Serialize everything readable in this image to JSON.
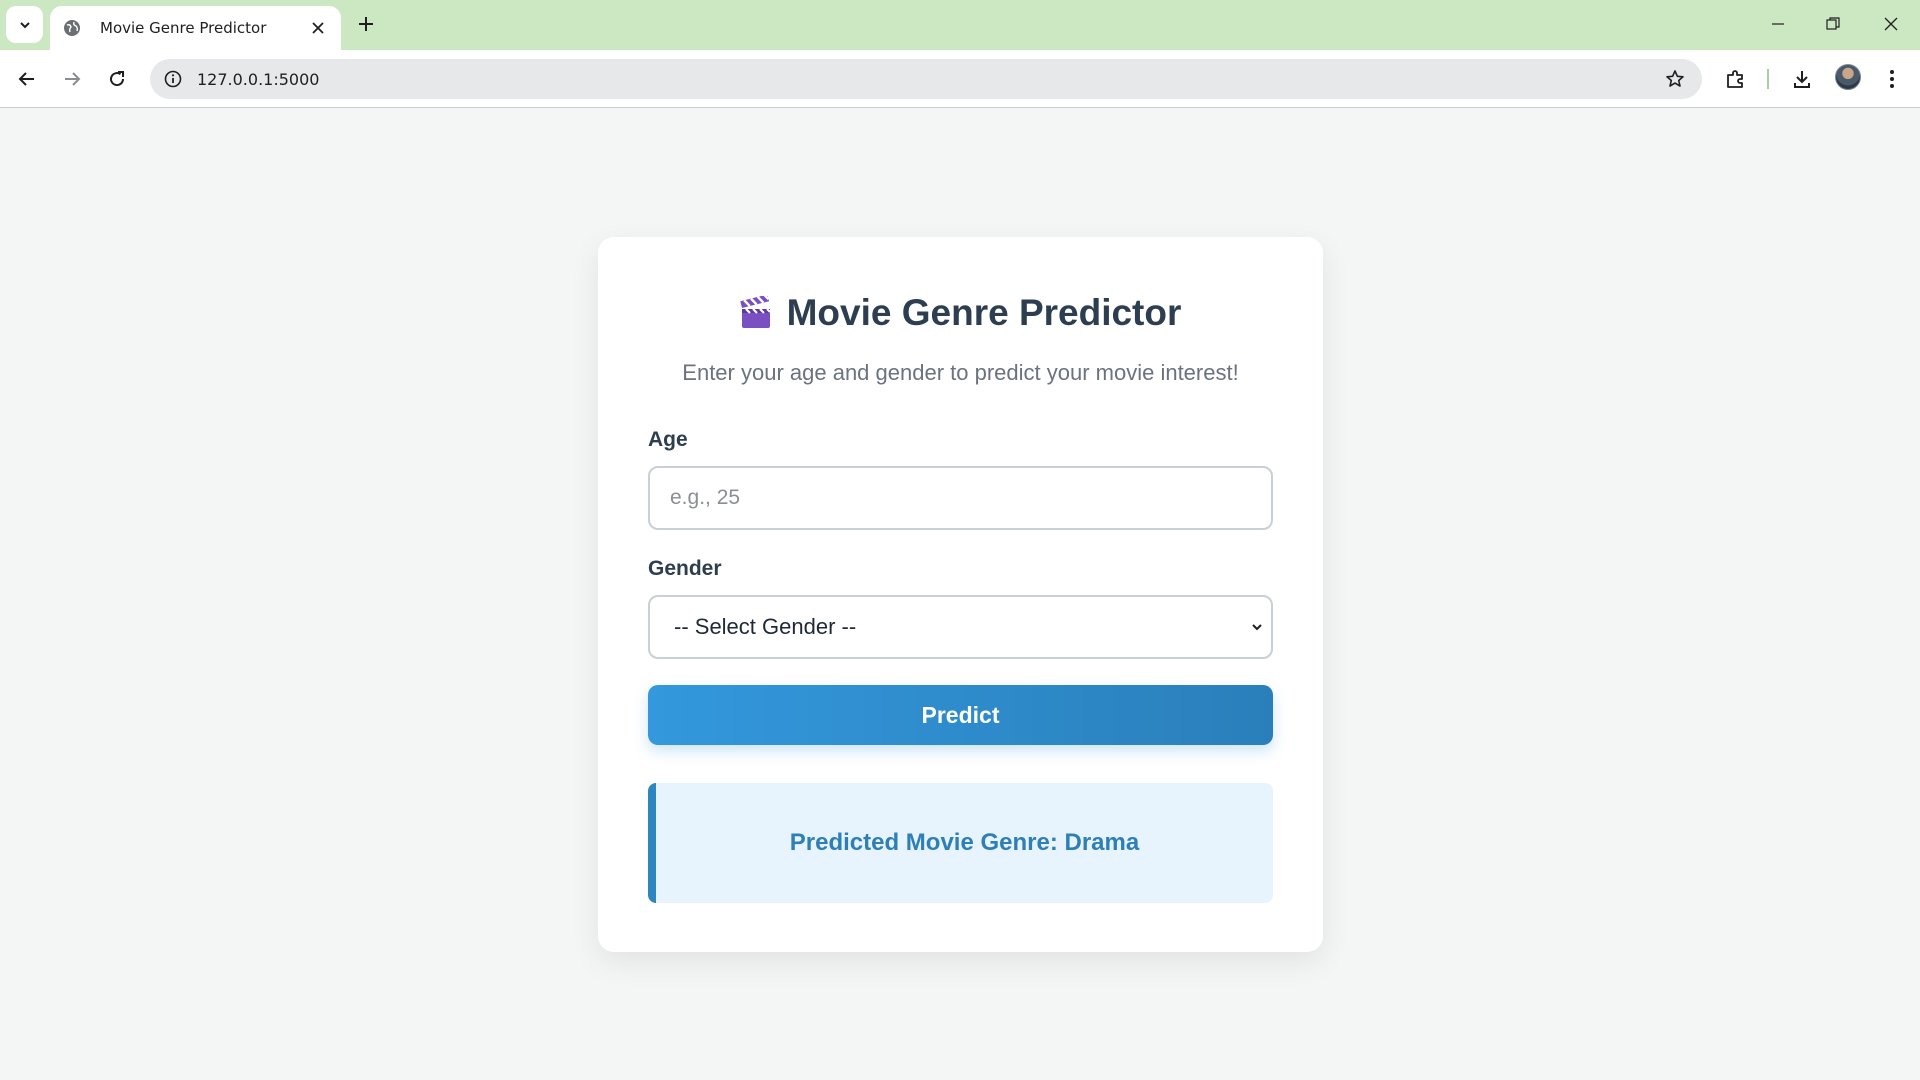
{
  "browser": {
    "tab_title": "Movie Genre Predictor",
    "url": "127.0.0.1:5000"
  },
  "page": {
    "title": "Movie Genre Predictor",
    "subtitle": "Enter your age and gender to predict your movie interest!",
    "age_label": "Age",
    "age_placeholder": "e.g., 25",
    "age_value": "",
    "gender_label": "Gender",
    "gender_selected": "-- Select Gender --",
    "predict_label": "Predict",
    "result_text": "Predicted Movie Genre: Drama"
  },
  "colors": {
    "tabbar": "#cbe8c3",
    "page_bg": "#f4f6f5",
    "title": "#2c3e50",
    "button": "#3398dd",
    "result_bg": "#e8f4fd",
    "result_text": "#2e7fb8"
  }
}
